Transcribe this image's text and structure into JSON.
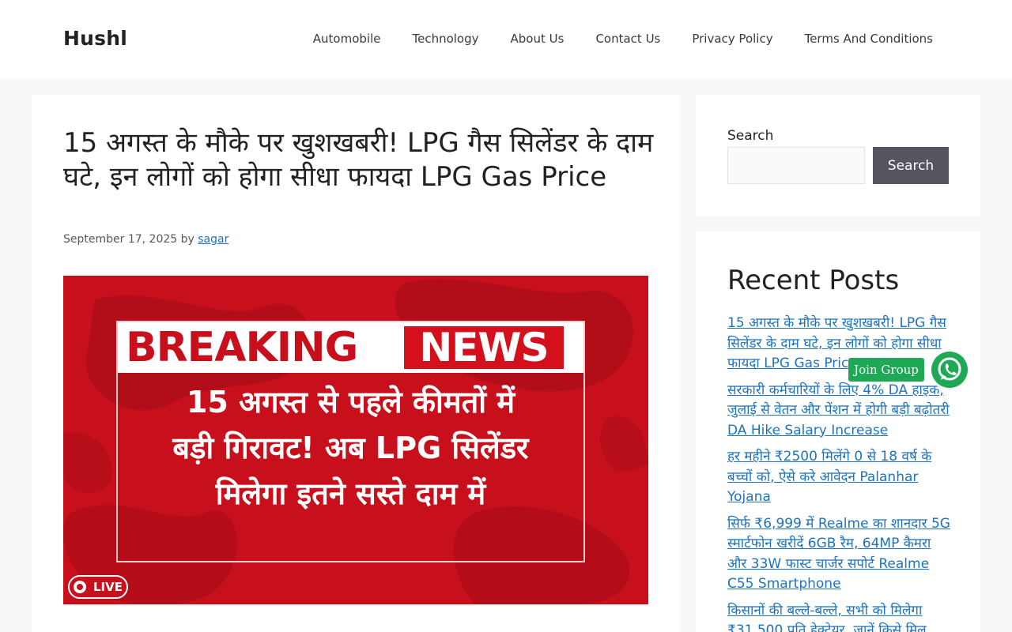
{
  "site": {
    "title": "Hushl"
  },
  "nav": {
    "items": [
      {
        "label": "Automobile"
      },
      {
        "label": "Technology"
      },
      {
        "label": "About Us"
      },
      {
        "label": "Contact Us"
      },
      {
        "label": "Privacy Policy"
      },
      {
        "label": "Terms And Conditions"
      }
    ]
  },
  "article": {
    "title": "15 अगस्त के मौके पर खुशखबरी! LPG गैस सिलेंडर के दाम घटे, इन लोगों को होगा सीधा फायदा LPG Gas Price",
    "date": "September 17, 2025",
    "by": "by",
    "author": "sagar",
    "image": {
      "breaking": "BREAKING",
      "news": "NEWS",
      "lines": [
        "15 अगस्त से पहले कीमतों में",
        "बड़ी गिरावट! अब LPG सिलेंडर",
        "मिलेगा इतने सस्ते दाम में"
      ],
      "live": "LIVE",
      "colors": {
        "red": "#c8101d",
        "white": "#ffffff"
      }
    }
  },
  "sidebar": {
    "search": {
      "label": "Search",
      "placeholder": "",
      "button": "Search"
    },
    "recent": {
      "title": "Recent Posts",
      "posts": [
        {
          "title": "15 अगस्त के मौके पर खुशखबरी! LPG गैस सिलेंडर के दाम घटे, इन लोगों को होगा सीधा फायदा LPG Gas Price"
        },
        {
          "title": "सरकारी कर्मचारियों के लिए 4% DA हाइक, जुलाई से वेतन और पेंशन में होगी बड़ी बढ़ोतरी DA Hike Salary Increase"
        },
        {
          "title": "हर महीने ₹2500 मिलेंगे 0 से 18 वर्ष के बच्चों को, ऐसे करे आवेदन Palanhar Yojana"
        },
        {
          "title": "सिर्फ ₹6,999 में Realme का शानदार 5G स्मार्टफोन खरीदें 6GB रैम, 64MP कैमरा और 33W फास्ट चार्जर सपोर्ट Realme C55 Smartphone"
        },
        {
          "title": "किसानों की बल्ले-बल्ले, सभी को मिलेगा ₹31,500 प्रति हेक्टेयर, जानें किसे मिल"
        }
      ]
    }
  },
  "floating": {
    "join_group": "Join Group",
    "whatsapp_icon": "whatsapp-icon",
    "color": "#1fa855"
  }
}
